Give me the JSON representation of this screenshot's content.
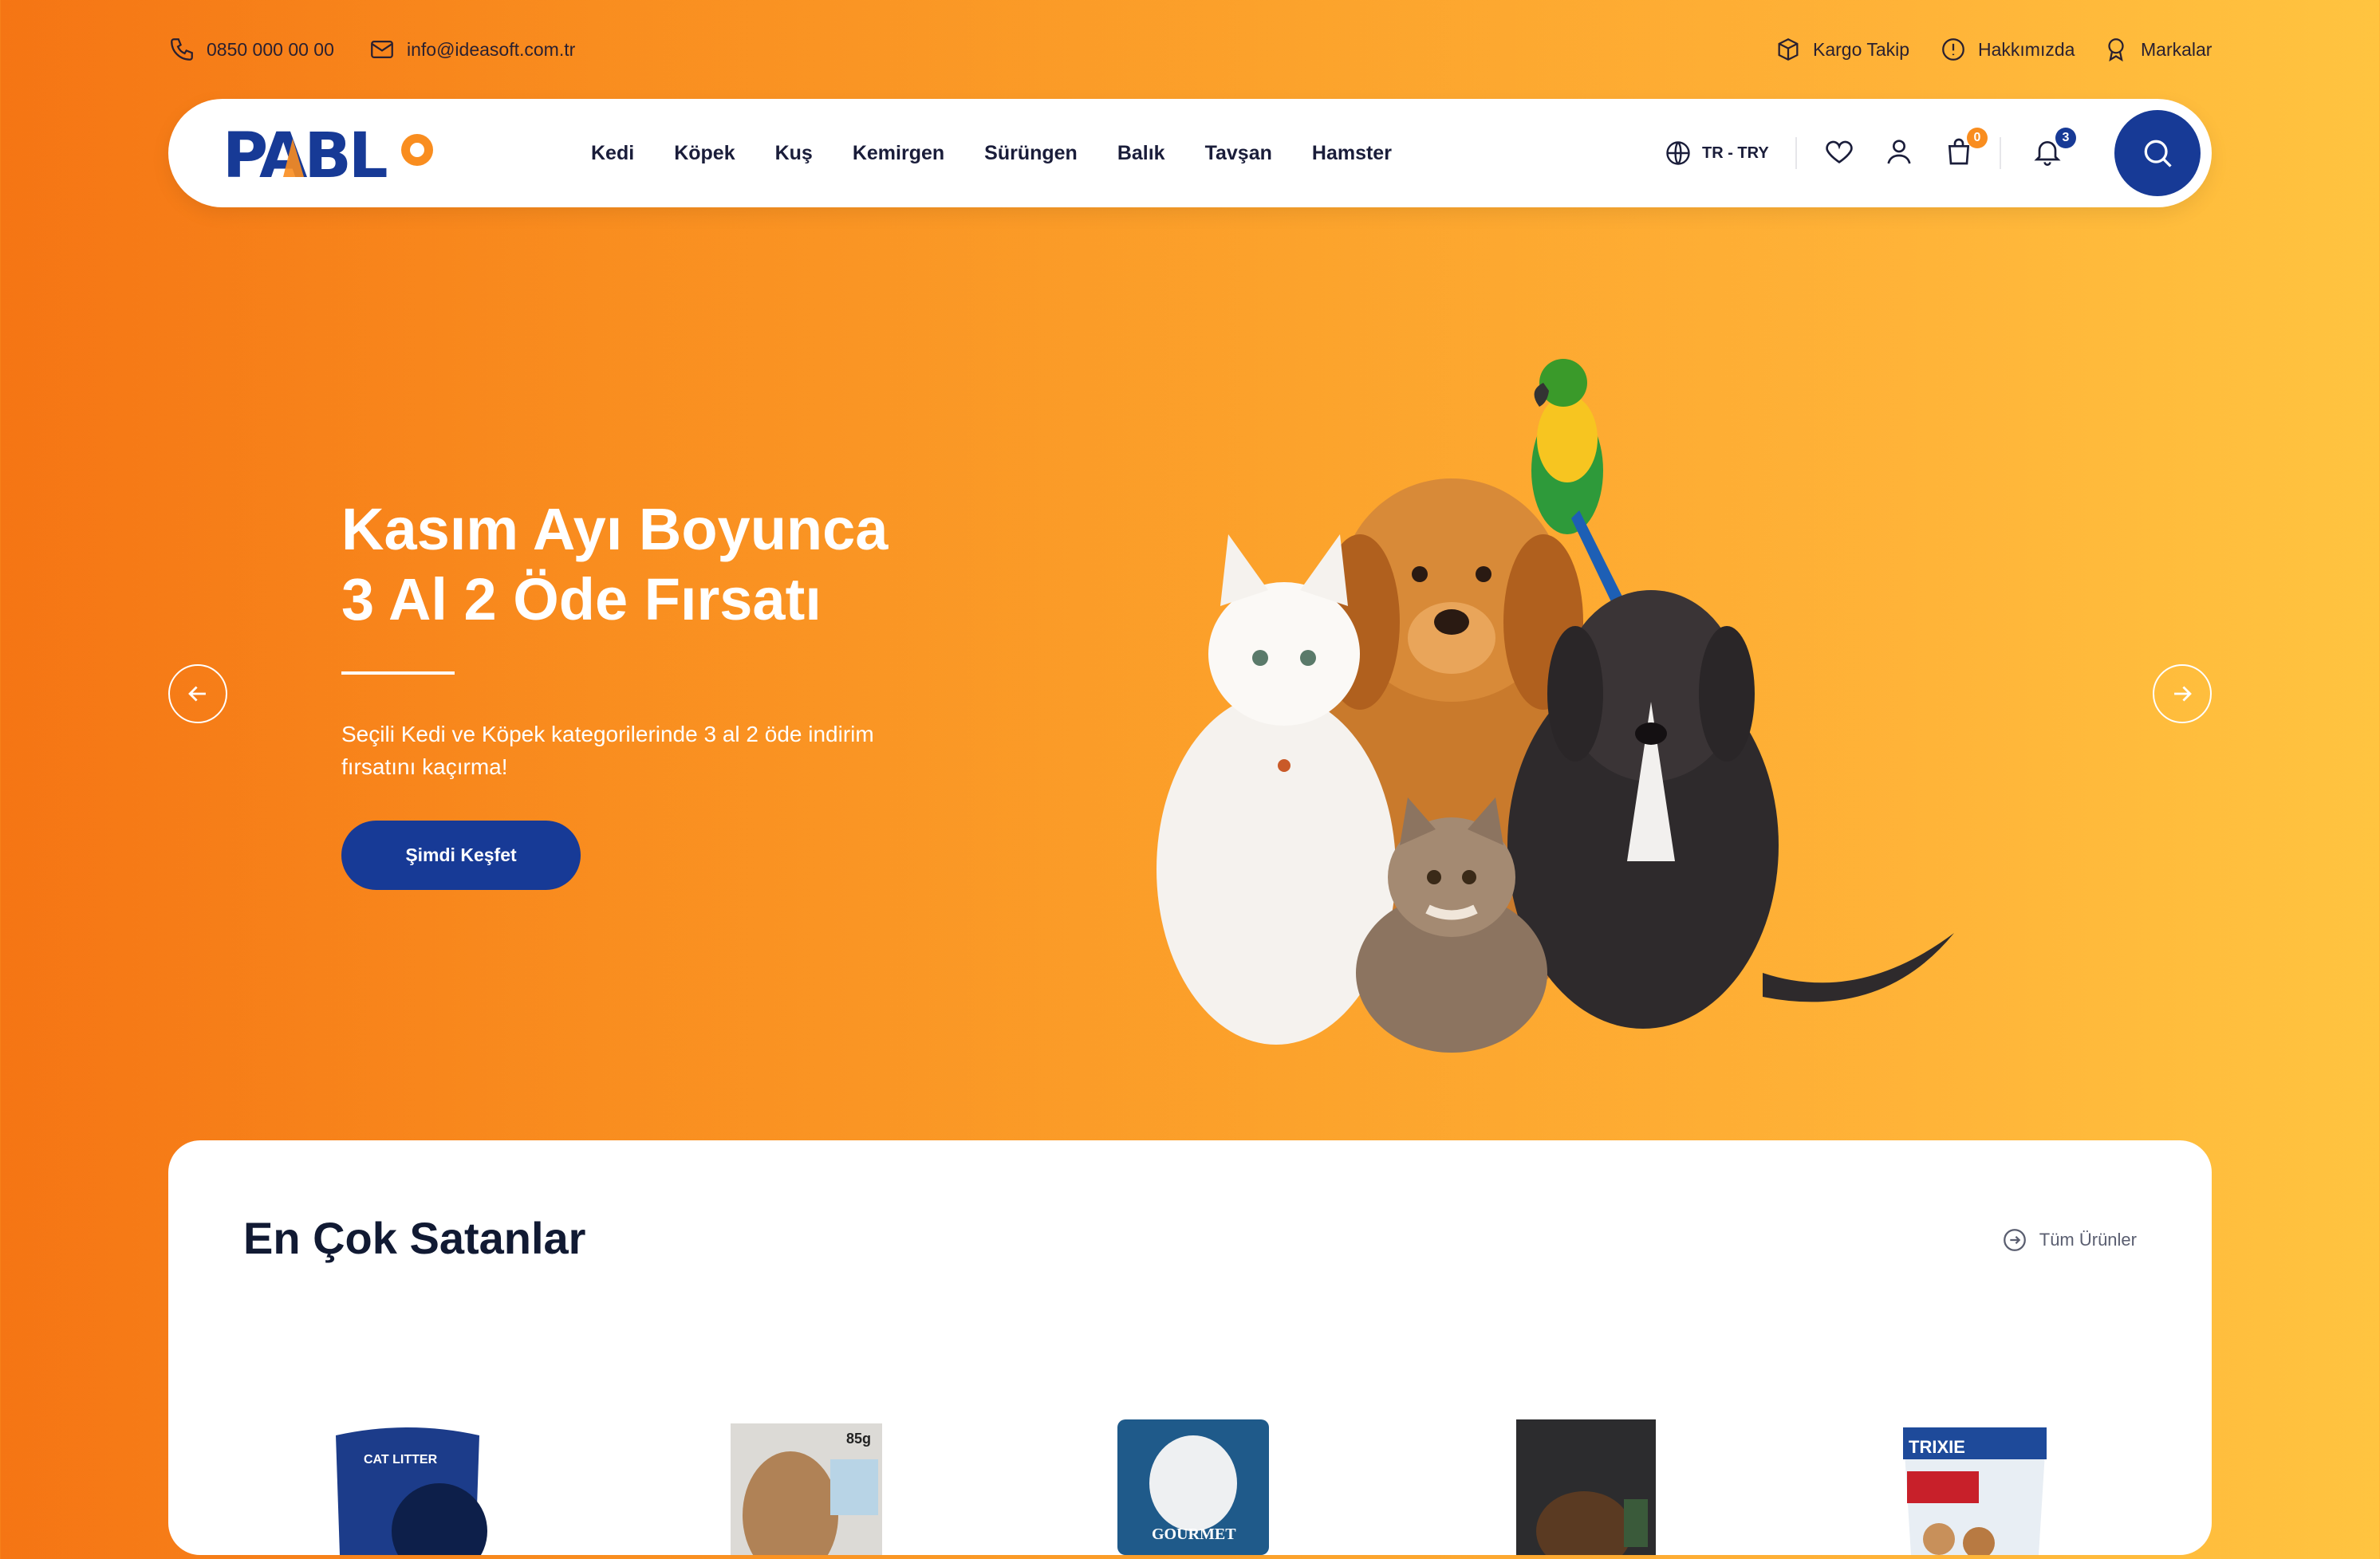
{
  "topbar": {
    "phone": "0850 000 00 00",
    "email": "info@ideasoft.com.tr",
    "links": [
      {
        "label": "Kargo Takip",
        "icon": "package-icon"
      },
      {
        "label": "Hakkımızda",
        "icon": "info-icon"
      },
      {
        "label": "Markalar",
        "icon": "badge-icon"
      }
    ]
  },
  "header": {
    "logo_text": "PABLO",
    "nav": [
      "Kedi",
      "Köpek",
      "Kuş",
      "Kemirgen",
      "Sürüngen",
      "Balık",
      "Tavşan",
      "Hamster"
    ],
    "language": "TR - TRY",
    "cart_count": "0",
    "notification_count": "3"
  },
  "hero": {
    "title_line1": "Kasım Ayı Boyunca",
    "title_line2": "3 Al 2 Öde Fırsatı",
    "description": "Seçili Kedi ve Köpek kategorilerinde 3 al 2 öde indirim fırsatını kaçırma!",
    "cta": "Şimdi Keşfet"
  },
  "bestsellers": {
    "title": "En Çok Satanlar",
    "all_products": "Tüm Ürünler",
    "products": [
      {
        "label": "CAT LITTER"
      },
      {
        "label": "85g"
      },
      {
        "label": "GOURMET"
      },
      {
        "label": ""
      },
      {
        "label": "TRIXIE"
      }
    ]
  },
  "colors": {
    "primary": "#173a96",
    "accent_orange": "#f57514",
    "badge_orange": "#f98d1f"
  }
}
